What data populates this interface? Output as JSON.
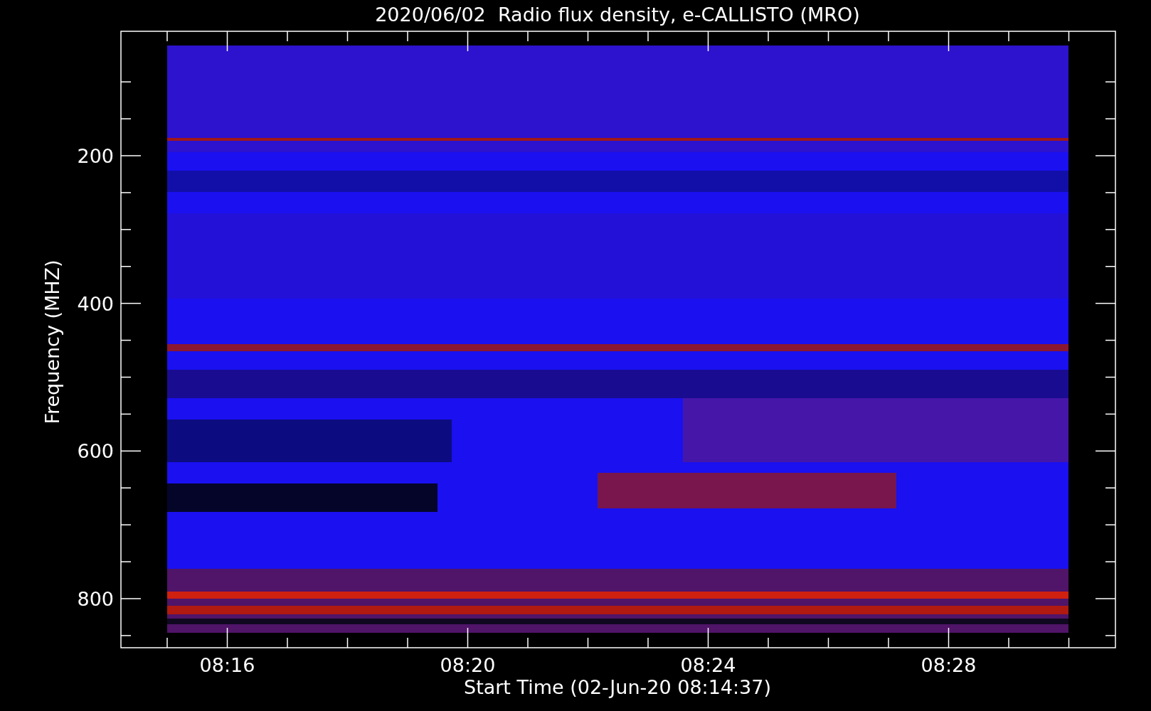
{
  "title": "2020/06/02  Radio flux density, e-CALLISTO (MRO)",
  "y_axis": {
    "label": "Frequency (MHZ)",
    "ticks": [
      "200",
      "400",
      "600",
      "800"
    ]
  },
  "x_axis": {
    "label": "Start Time (02-Jun-20 08:14:37)",
    "ticks": [
      "08:16",
      "08:20",
      "08:24",
      "08:28"
    ]
  }
}
